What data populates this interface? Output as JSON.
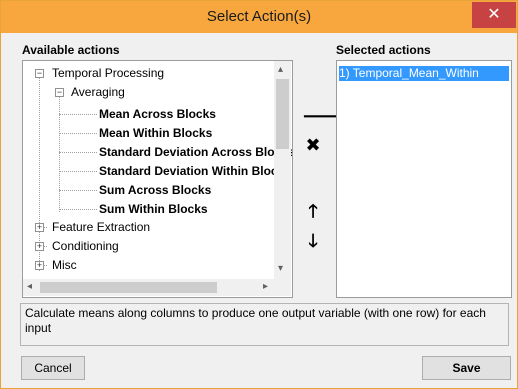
{
  "window": {
    "title": "Select Action(s)",
    "close_glyph": "✕"
  },
  "available": {
    "label": "Available actions",
    "tree": [
      {
        "label": "Temporal Processing",
        "expander": "−"
      },
      {
        "label": "Averaging",
        "expander": "−"
      },
      {
        "label": "Mean Across Blocks"
      },
      {
        "label": "Mean Within Blocks"
      },
      {
        "label": "Standard Deviation Across Blocks"
      },
      {
        "label": "Standard Deviation Within Blocks"
      },
      {
        "label": "Sum Across Blocks"
      },
      {
        "label": "Sum Within Blocks"
      },
      {
        "label": "Feature Extraction",
        "expander": "+"
      },
      {
        "label": "Conditioning",
        "expander": "+"
      },
      {
        "label": "Misc",
        "expander": "+"
      }
    ]
  },
  "selected": {
    "label": "Selected actions",
    "items": [
      "1) Temporal_Mean_Within"
    ]
  },
  "controls": {
    "add_icon": "arrow-right-icon",
    "remove_icon": "x-icon",
    "up_icon": "arrow-up-icon",
    "down_icon": "arrow-down-icon",
    "add_glyph": "🡒",
    "remove_glyph": "✖",
    "up_glyph": "🡑",
    "down_glyph": "🡓"
  },
  "scroll": {
    "up": "▴",
    "down": "▾",
    "left": "◂",
    "right": "▸"
  },
  "description": "Calculate means along columns to produce one output variable (with one row) for each input",
  "buttons": {
    "cancel": "Cancel",
    "save": "Save"
  },
  "colors": {
    "title_bar": "#f7a73d",
    "close": "#c74343",
    "selection": "#3399ff"
  }
}
